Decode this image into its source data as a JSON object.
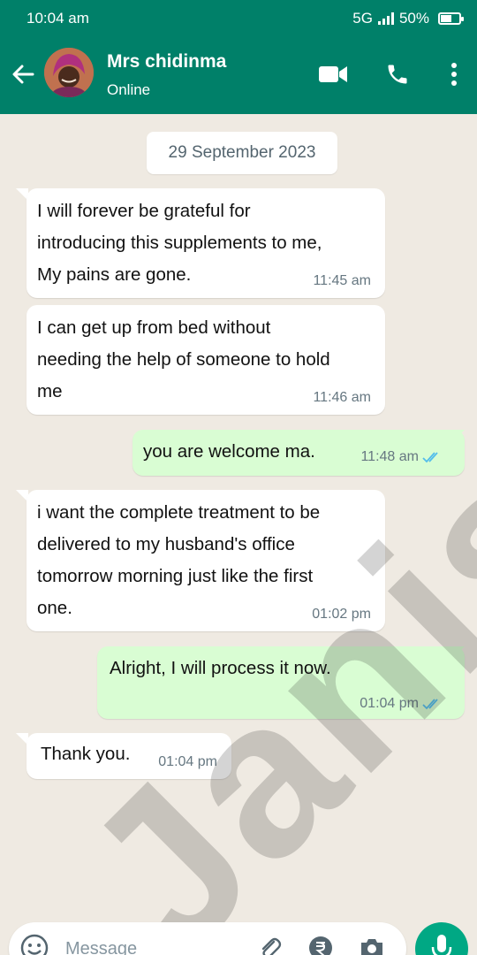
{
  "status_bar": {
    "time": "10:04 am",
    "network": "5G",
    "battery": "50%"
  },
  "header": {
    "contact_name": "Mrs chidinma",
    "contact_status": "Online"
  },
  "date_separator": "29 September 2023",
  "messages": [
    {
      "direction": "in",
      "text": "I will forever be grateful for\nintroducing this supplements to me,\nMy pains are gone.",
      "time": "11:45 am"
    },
    {
      "direction": "in",
      "text": "I can get up from bed without\nneeding the help of someone to hold\nme",
      "time": "11:46 am"
    },
    {
      "direction": "out",
      "text": "you are welcome ma.",
      "time": "11:48 am",
      "read": true
    },
    {
      "direction": "in",
      "text": "i want the complete treatment to be\ndelivered to my husband's office\ntomorrow morning just like the first\none.",
      "time": "01:02 pm"
    },
    {
      "direction": "out",
      "text": "Alright, I will process it now.",
      "time": "01:04 pm",
      "read": true
    },
    {
      "direction": "in",
      "text": "Thank you.",
      "time": "01:04 pm"
    }
  ],
  "watermark": "Janis",
  "input": {
    "placeholder": "Message"
  },
  "colors": {
    "header": "#008069",
    "chat_bg": "#efeae2",
    "outgoing_bubble": "#d9fdd3",
    "incoming_bubble": "#ffffff",
    "read_ticks": "#53bdeb",
    "mic_button": "#00a884"
  }
}
